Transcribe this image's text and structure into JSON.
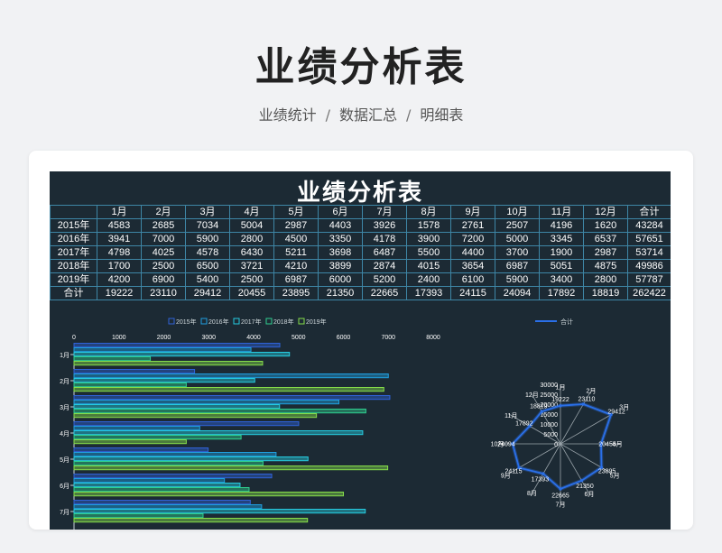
{
  "page": {
    "title": "业绩分析表",
    "breadcrumb": [
      "业绩统计",
      "数据汇总",
      "明细表"
    ],
    "separator": "/"
  },
  "sheet": {
    "title": "业绩分析表",
    "columns": [
      "",
      "1月",
      "2月",
      "3月",
      "4月",
      "5月",
      "6月",
      "7月",
      "8月",
      "9月",
      "10月",
      "11月",
      "12月",
      "合计"
    ],
    "rows": [
      [
        "2015年",
        "4583",
        "2685",
        "7034",
        "5004",
        "2987",
        "4403",
        "3926",
        "1578",
        "2761",
        "2507",
        "4196",
        "1620",
        "43284"
      ],
      [
        "2016年",
        "3941",
        "7000",
        "5900",
        "2800",
        "4500",
        "3350",
        "4178",
        "3900",
        "7200",
        "5000",
        "3345",
        "6537",
        "57651"
      ],
      [
        "2017年",
        "4798",
        "4025",
        "4578",
        "6430",
        "5211",
        "3698",
        "6487",
        "5500",
        "4400",
        "3700",
        "1900",
        "2987",
        "53714"
      ],
      [
        "2018年",
        "1700",
        "2500",
        "6500",
        "3721",
        "4210",
        "3899",
        "2874",
        "4015",
        "3654",
        "6987",
        "5051",
        "4875",
        "49986"
      ],
      [
        "2019年",
        "4200",
        "6900",
        "5400",
        "2500",
        "6987",
        "6000",
        "5200",
        "2400",
        "6100",
        "5900",
        "3400",
        "2800",
        "57787"
      ],
      [
        "合计",
        "19222",
        "23110",
        "29412",
        "20455",
        "23895",
        "21350",
        "22665",
        "17393",
        "24115",
        "24094",
        "17892",
        "18819",
        "262422"
      ]
    ]
  },
  "colors": {
    "background": "#f1f2f4",
    "sheet_bg": "#1c2a34",
    "grid": "#3e86a6",
    "series": [
      "#2f62d8",
      "#1f9fe0",
      "#25cbe0",
      "#2fcf8f",
      "#86dd4a"
    ],
    "radar": "#2a6fe8"
  },
  "chart_data": [
    {
      "type": "bar",
      "orientation": "horizontal",
      "categories": [
        "1月",
        "2月",
        "3月",
        "4月",
        "5月",
        "6月",
        "7月"
      ],
      "series": [
        {
          "name": "2015年",
          "values": [
            4583,
            2685,
            7034,
            5004,
            2987,
            4403,
            3926
          ]
        },
        {
          "name": "2016年",
          "values": [
            3941,
            7000,
            5900,
            2800,
            4500,
            3350,
            4178
          ]
        },
        {
          "name": "2017年",
          "values": [
            4798,
            4025,
            4578,
            6430,
            5211,
            3698,
            6487
          ]
        },
        {
          "name": "2018年",
          "values": [
            1700,
            2500,
            6500,
            3721,
            4210,
            3899,
            2874
          ]
        },
        {
          "name": "2019年",
          "values": [
            4200,
            6900,
            5400,
            2500,
            6987,
            6000,
            5200
          ]
        }
      ],
      "xticks": [
        "0",
        "1000",
        "2000",
        "3000",
        "4000",
        "5000",
        "6000",
        "7000",
        "8000"
      ],
      "xlim": [
        0,
        8000
      ],
      "legend": "top"
    },
    {
      "type": "radar",
      "categories": [
        "1月",
        "2月",
        "3月",
        "4月",
        "5月",
        "6月",
        "7月",
        "8月",
        "9月",
        "10月",
        "11月",
        "12月"
      ],
      "series": [
        {
          "name": "合计",
          "values": [
            19222,
            23110,
            29412,
            20455,
            23895,
            21350,
            22665,
            17393,
            24115,
            24094,
            17892,
            18819
          ]
        }
      ],
      "rticks": [
        "0",
        "5000",
        "10000",
        "15000",
        "20000",
        "25000",
        "30000"
      ],
      "rlim": [
        0,
        30000
      ],
      "legend": "top"
    }
  ]
}
